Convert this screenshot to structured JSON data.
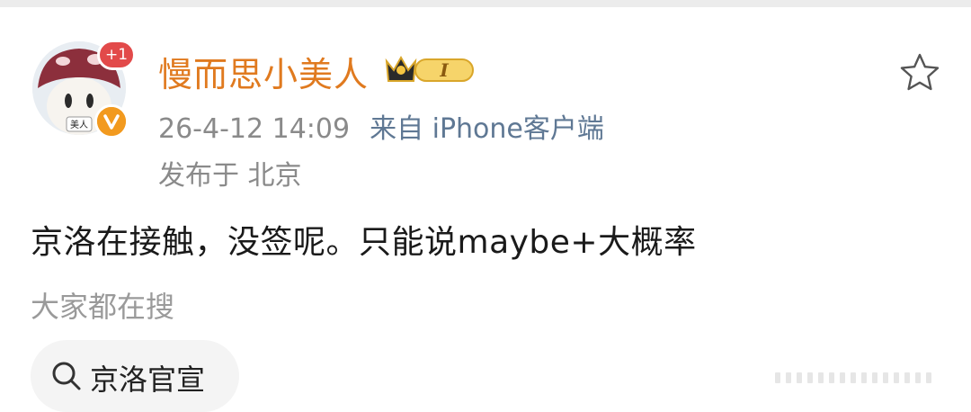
{
  "user": {
    "name": "慢而思小美人",
    "plus_badge": "+1",
    "avatar_caption": "美人",
    "vip_level_glyph": "I"
  },
  "post": {
    "time": "26-4-12 14:09",
    "source": "来自 iPhone客户端",
    "location": "发布于 北京",
    "text": "京洛在接触，没签呢。只能说maybe+大概率"
  },
  "related": {
    "label": "大家都在搜",
    "chips": [
      {
        "label": "京洛官宣",
        "icon": "search-icon"
      }
    ]
  },
  "colors": {
    "username": "#e07a1f",
    "plus_badge": "#e24a4a",
    "verified_badge": "#f29a1f",
    "source_link": "#5f7894"
  },
  "icons": {
    "favorite": "star-outline-icon",
    "verified": "verified-v-icon",
    "vip": "crown-vip-icon"
  }
}
